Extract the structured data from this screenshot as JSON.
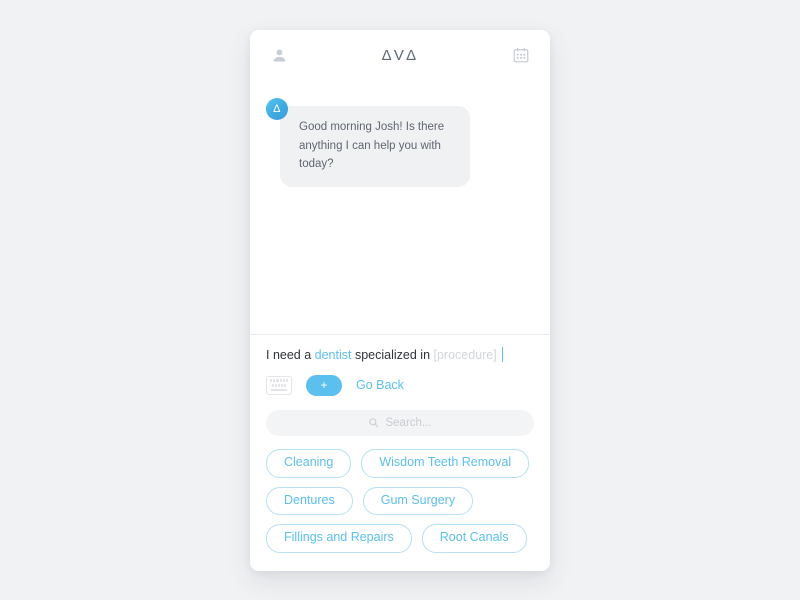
{
  "header": {
    "profile_icon": "person-icon",
    "brand": "ΔVΔ",
    "calendar_icon": "calendar-icon"
  },
  "conversation": {
    "messages": [
      {
        "sender": "assistant",
        "avatar_initial": "Δ",
        "text": "Good morning Josh! Is there anything I can help you with today?"
      }
    ]
  },
  "composer": {
    "prefix": "I need a ",
    "entity": "dentist",
    "middle": " specialized in ",
    "placeholder_token": "[procedure]",
    "keyboard_icon": "keyboard-icon",
    "add_label": "+",
    "go_back_label": "Go Back"
  },
  "search": {
    "icon": "search-icon",
    "placeholder": "Search..."
  },
  "chips": {
    "rows": [
      [
        "Cleaning",
        "Wisdom Teeth Removal"
      ],
      [
        "Dentures",
        "Gum Surgery"
      ],
      [
        "Fillings and Repairs",
        "Root Canals"
      ]
    ]
  },
  "colors": {
    "accent": "#5cc0ef",
    "chip_border": "#b7e0f4",
    "page_background": "#f1f2f4",
    "bubble_background": "#f0f1f3",
    "text_primary": "#30343b",
    "text_muted": "#c9ccd1"
  }
}
